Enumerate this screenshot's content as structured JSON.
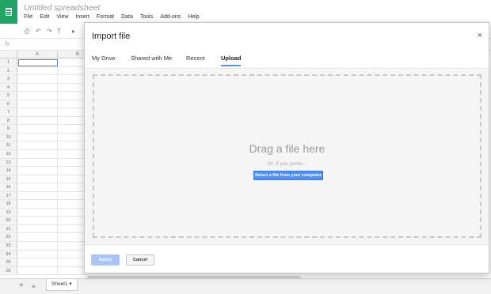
{
  "app": {
    "doc_title": "Untitled spreadsheet",
    "menu": [
      "File",
      "Edit",
      "View",
      "Insert",
      "Format",
      "Data",
      "Tools",
      "Add-ons",
      "Help"
    ],
    "formula_label": "fx",
    "column_headers": [
      "A",
      "B"
    ],
    "row_numbers": [
      "1",
      "2",
      "3",
      "4",
      "5",
      "6",
      "7",
      "8",
      "9",
      "10",
      "11",
      "12",
      "13",
      "14",
      "15",
      "16",
      "17",
      "18",
      "19",
      "20",
      "21",
      "22",
      "23",
      "24",
      "25",
      "26"
    ],
    "sheet_tab": "Sheet1 ▾",
    "add_sheet_icon": "+",
    "sheet_list_icon": "≡",
    "brand_color": "#21a366"
  },
  "toolbar": {
    "print_icon": "⎙",
    "undo_icon": "↶",
    "redo_icon": "↷",
    "paint_format_icon": "T",
    "more_icon": "▸"
  },
  "dialog": {
    "title": "Import file",
    "close_icon": "×",
    "tabs": [
      "My Drive",
      "Shared with Me",
      "Recent",
      "Upload"
    ],
    "active_tab": "Upload",
    "drag_text": "Drag a file here",
    "or_text": "Or, if you prefer...",
    "select_button": "Select a file from your computer",
    "primary_button": "Select",
    "cancel_button": "Cancel",
    "accent_color": "#4d90fe"
  }
}
